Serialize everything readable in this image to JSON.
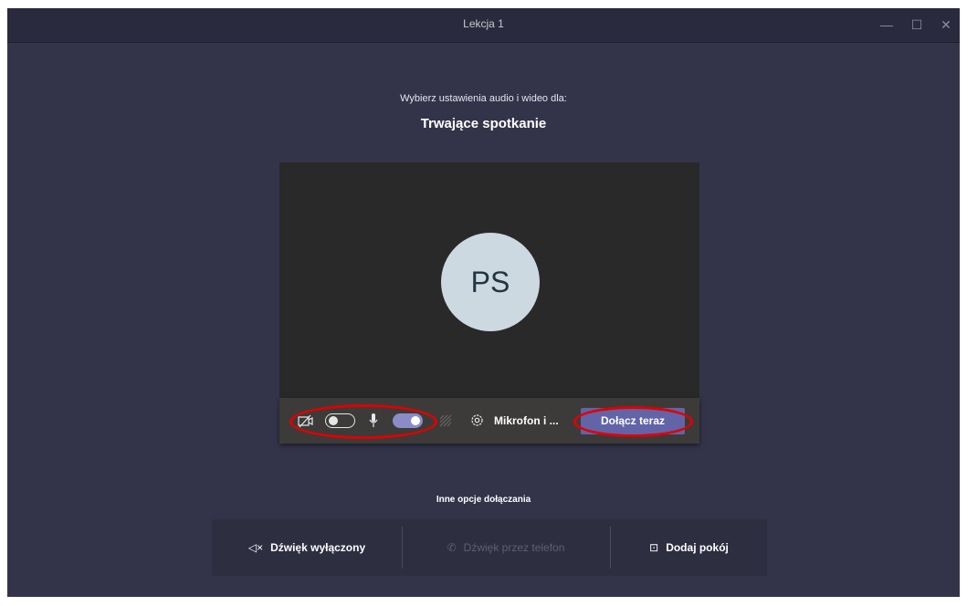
{
  "window": {
    "title": "Lekcja 1",
    "controls": {
      "minimize": "—",
      "maximize": "☐",
      "close": "✕"
    }
  },
  "header": {
    "subtitle": "Wybierz ustawienia audio i wideo dla:",
    "meeting_name": "Trwające spotkanie"
  },
  "preview": {
    "avatar_initials": "PS"
  },
  "controls": {
    "camera_on": false,
    "microphone_on": true,
    "device_label": "Mikrofon i ...",
    "join_label": "Dołącz teraz"
  },
  "other_options": {
    "label": "Inne opcje dołączania",
    "items": [
      {
        "icon": "speaker-off-icon",
        "label": "Dźwięk wyłączony",
        "enabled": true
      },
      {
        "icon": "phone-icon",
        "label": "Dźwięk przez telefon",
        "enabled": false
      },
      {
        "icon": "cast-icon",
        "label": "Dodaj pokój",
        "enabled": true
      }
    ]
  },
  "colors": {
    "background": "#33344a",
    "accent": "#6264a7",
    "annotation": "#e00000"
  }
}
